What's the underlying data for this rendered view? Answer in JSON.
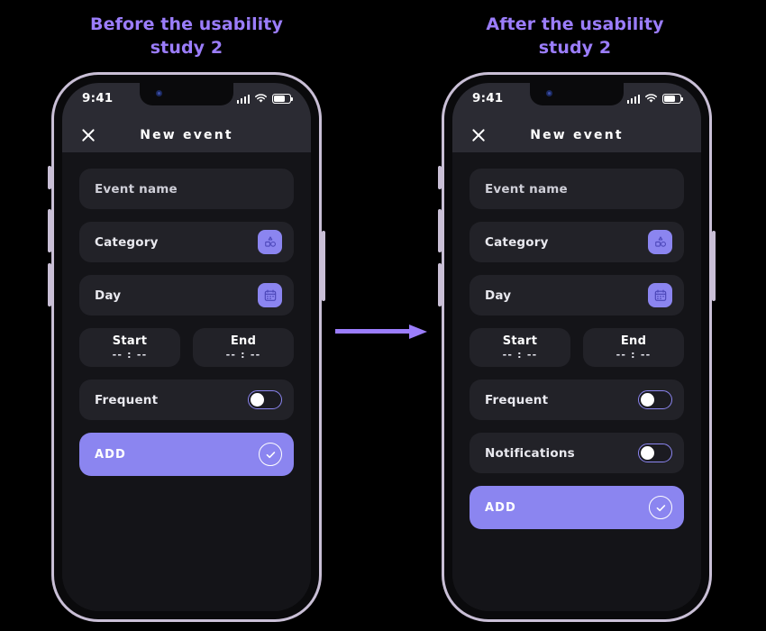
{
  "titles": {
    "left": "Before the usability\nstudy 2",
    "left_line1": "Before the usability",
    "left_line2": "study 2",
    "right_line1": "After the usability",
    "right_line2": "study 2"
  },
  "colors": {
    "accent_purple": "#8b85f0",
    "title_purple": "#9b7dfb",
    "screen_bg": "#141418",
    "field_bg": "#222228",
    "header_bg": "#2b2b33",
    "frame_silver": "#c9bfd6",
    "bezel_black": "#0a0a0c"
  },
  "arrow": {
    "direction": "right",
    "color": "#9b7dfb"
  },
  "phones": [
    {
      "id": "before",
      "status_bar": {
        "time": "9:41",
        "signal": "signal-bars-icon",
        "wifi": "wifi-icon",
        "battery": "battery-icon",
        "battery_level": 72
      },
      "header": {
        "close": "close-icon",
        "title": "New event"
      },
      "fields": [
        {
          "type": "text",
          "label": "Event name",
          "placeholder": true
        },
        {
          "type": "picker",
          "label": "Category",
          "icon": "shapes-icon"
        },
        {
          "type": "picker",
          "label": "Day",
          "icon": "calendar-icon"
        }
      ],
      "time_row": [
        {
          "label": "Start",
          "value": "-- : --"
        },
        {
          "label": "End",
          "value": "-- : --"
        }
      ],
      "toggles": [
        {
          "label": "Frequent",
          "on": false
        }
      ],
      "primary_button": {
        "label": "ADD",
        "icon": "check-circle-icon"
      }
    },
    {
      "id": "after",
      "status_bar": {
        "time": "9:41",
        "signal": "signal-bars-icon",
        "wifi": "wifi-icon",
        "battery": "battery-icon",
        "battery_level": 72
      },
      "header": {
        "close": "close-icon",
        "title": "New event"
      },
      "fields": [
        {
          "type": "text",
          "label": "Event name",
          "placeholder": true
        },
        {
          "type": "picker",
          "label": "Category",
          "icon": "shapes-icon"
        },
        {
          "type": "picker",
          "label": "Day",
          "icon": "calendar-icon"
        }
      ],
      "time_row": [
        {
          "label": "Start",
          "value": "-- : --"
        },
        {
          "label": "End",
          "value": "-- : --"
        }
      ],
      "toggles": [
        {
          "label": "Frequent",
          "on": false
        },
        {
          "label": "Notifications",
          "on": false
        }
      ],
      "primary_button": {
        "label": "ADD",
        "icon": "check-circle-icon"
      }
    }
  ]
}
